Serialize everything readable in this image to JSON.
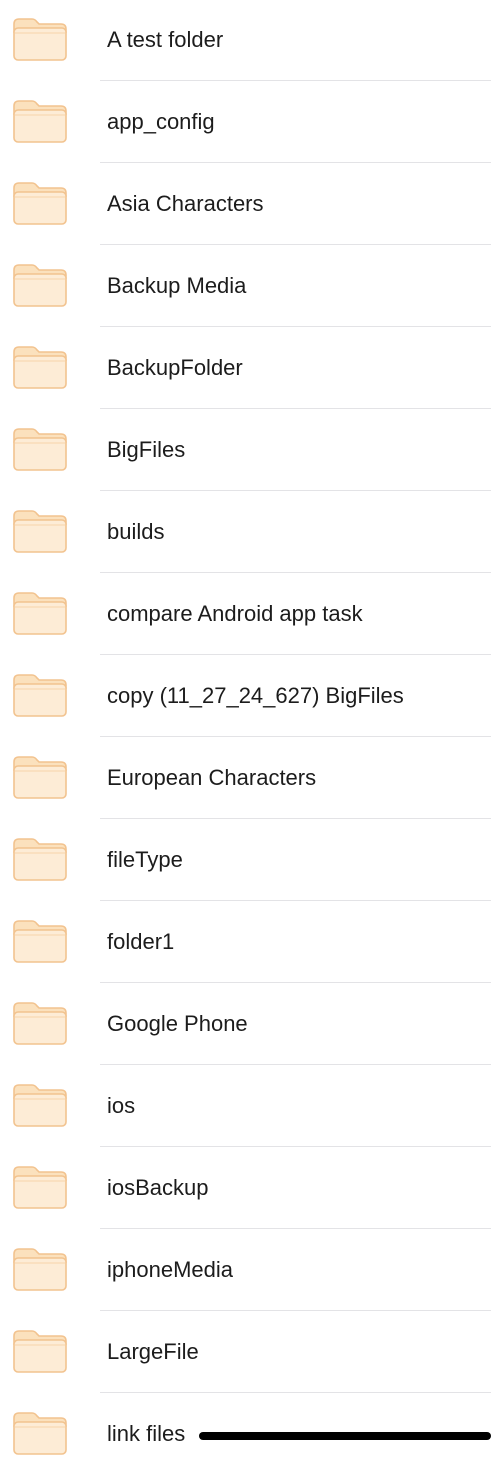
{
  "folder_icon": {
    "name": "folder-icon",
    "fill": "#fdecd6",
    "tab_fill": "#fbe1bd",
    "stroke": "#f2c38f"
  },
  "folders": [
    {
      "name": "A test folder"
    },
    {
      "name": "app_config"
    },
    {
      "name": "Asia Characters"
    },
    {
      "name": "Backup Media"
    },
    {
      "name": "BackupFolder"
    },
    {
      "name": "BigFiles"
    },
    {
      "name": "builds"
    },
    {
      "name": "compare Android app task"
    },
    {
      "name": "copy (11_27_24_627) BigFiles"
    },
    {
      "name": "European Characters"
    },
    {
      "name": "fileType"
    },
    {
      "name": "folder1"
    },
    {
      "name": "Google Phone"
    },
    {
      "name": "ios"
    },
    {
      "name": "iosBackup"
    },
    {
      "name": "iphoneMedia"
    },
    {
      "name": "LargeFile"
    },
    {
      "name": "link files"
    }
  ]
}
